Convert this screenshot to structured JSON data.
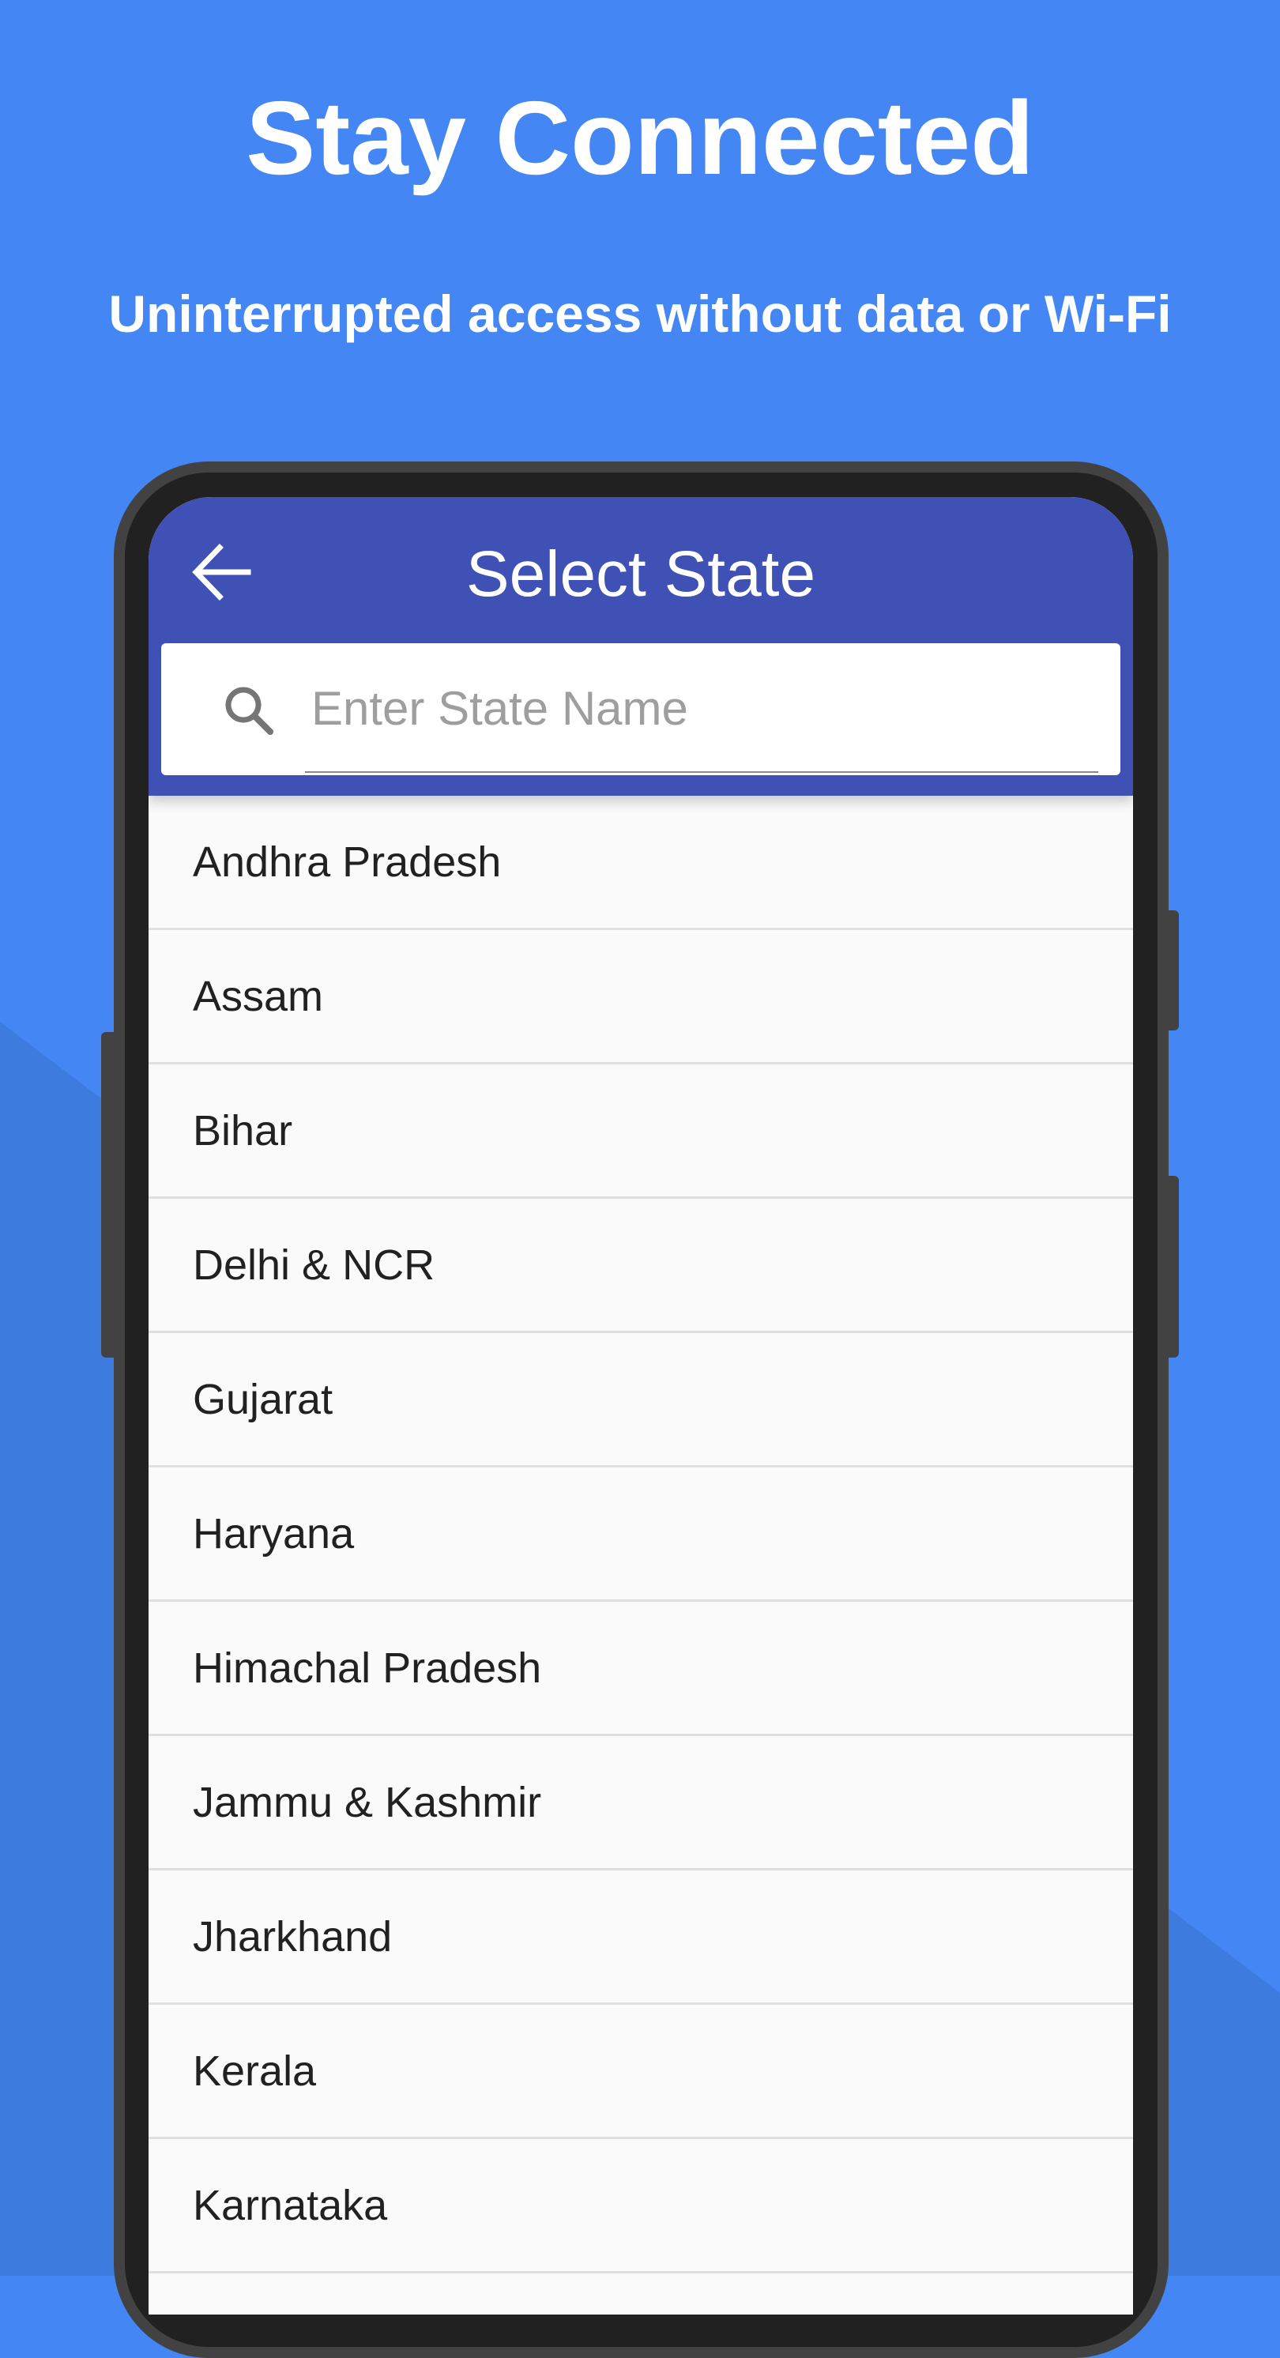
{
  "promo": {
    "headline": "Stay Connected",
    "subheadline": "Uninterrupted access without data or Wi-Fi"
  },
  "colors": {
    "background": "#4487F4",
    "background_shade": "#3D7BDF",
    "app_bar": "#3F51B5",
    "phone_frame": "#212121"
  },
  "app_bar": {
    "back_icon": "arrow-left-icon",
    "title": "Select State"
  },
  "search": {
    "icon": "search-icon",
    "placeholder": "Enter State Name",
    "value": ""
  },
  "states": [
    "Andhra Pradesh",
    "Assam",
    "Bihar",
    "Delhi & NCR",
    "Gujarat",
    "Haryana",
    "Himachal Pradesh",
    "Jammu & Kashmir",
    "Jharkhand",
    "Kerala",
    "Karnataka"
  ]
}
